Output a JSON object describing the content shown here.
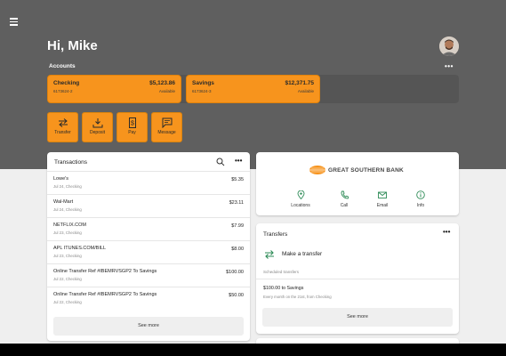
{
  "greeting": "Hi, Mike",
  "accounts": {
    "label": "Accounts",
    "more": "•••",
    "items": [
      {
        "name": "Checking",
        "balance": "$5,123.86",
        "number": "6173624-2",
        "available": "Available"
      },
      {
        "name": "Savings",
        "balance": "$12,371.75",
        "number": "6173624-3",
        "available": "Available"
      }
    ]
  },
  "quick_actions": [
    {
      "label": "Transfer",
      "icon": "transfer-icon"
    },
    {
      "label": "Deposit",
      "icon": "deposit-icon"
    },
    {
      "label": "Pay",
      "icon": "pay-icon"
    },
    {
      "label": "Message",
      "icon": "message-icon"
    }
  ],
  "transactions": {
    "title": "Transactions",
    "more": "•••",
    "see_more": "See more",
    "items": [
      {
        "desc": "Lowe's",
        "sub": "Jul 24, Checking",
        "amount": "$5.35"
      },
      {
        "desc": "Wal-Mart",
        "sub": "Jul 24, Checking",
        "amount": "$23.11"
      },
      {
        "desc": "NETFLIX.COM",
        "sub": "Jul 23, Checking",
        "amount": "$7.99"
      },
      {
        "desc": "APL ITUNES.COM/BILL",
        "sub": "Jul 23, Checking",
        "amount": "$8.00"
      },
      {
        "desc": "Online Transfer Ref #IBEMRVSGP2 To Savings",
        "sub": "Jul 22, Checking",
        "amount": "$100.00"
      },
      {
        "desc": "Online Transfer Ref #IBEMRVSGP2 To Savings",
        "sub": "Jul 22, Checking",
        "amount": "$50.00"
      }
    ]
  },
  "bank": {
    "name": "GREAT SOUTHERN BANK",
    "actions": [
      {
        "label": "Locations",
        "icon": "location-pin-icon"
      },
      {
        "label": "Call",
        "icon": "phone-icon"
      },
      {
        "label": "Email",
        "icon": "email-icon"
      },
      {
        "label": "Info",
        "icon": "info-icon"
      }
    ]
  },
  "transfers": {
    "title": "Transfers",
    "more": "•••",
    "make_label": "Make a transfer",
    "scheduled_label": "Scheduled transfers",
    "scheduled_amount": "$100.00 to Savings",
    "scheduled_freq": "Every month on the 21st, from Checking",
    "see_more": "See more"
  },
  "colors": {
    "accent": "#f7941d",
    "header": "#5f5f5f",
    "icon_green": "#2e8b57"
  }
}
